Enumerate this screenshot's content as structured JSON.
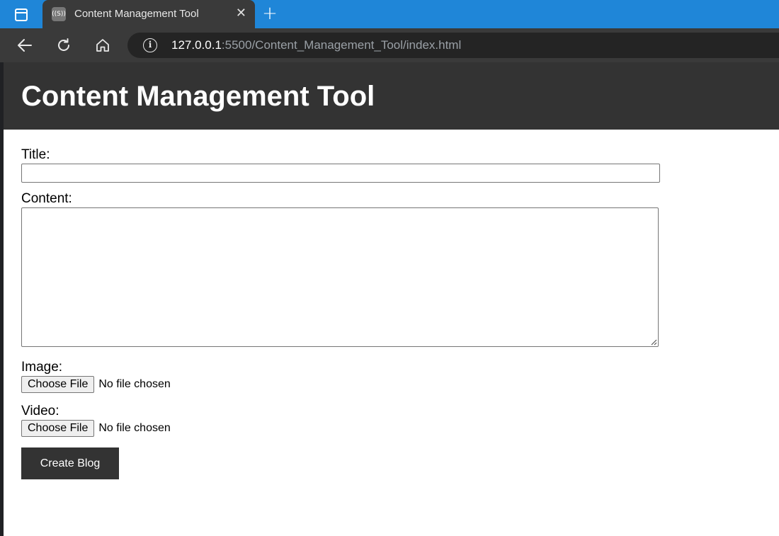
{
  "browser": {
    "tab_title": "Content Management Tool",
    "favicon_text": "((S))",
    "close_glyph": "✕",
    "new_tab_glyph": "+",
    "url_host": "127.0.0.1",
    "url_rest": ":5500/Content_Management_Tool/index.html"
  },
  "page": {
    "title": "Content Management Tool"
  },
  "form": {
    "title_label": "Title:",
    "title_value": "",
    "content_label": "Content:",
    "content_value": "",
    "image_label": "Image:",
    "video_label": "Video:",
    "choose_file_label": "Choose File",
    "no_file_text": "No file chosen",
    "submit_label": "Create Blog"
  },
  "colors": {
    "tabstrip": "#1f86d8",
    "toolbar": "#3a3a3a",
    "header": "#333333",
    "button": "#333333"
  }
}
